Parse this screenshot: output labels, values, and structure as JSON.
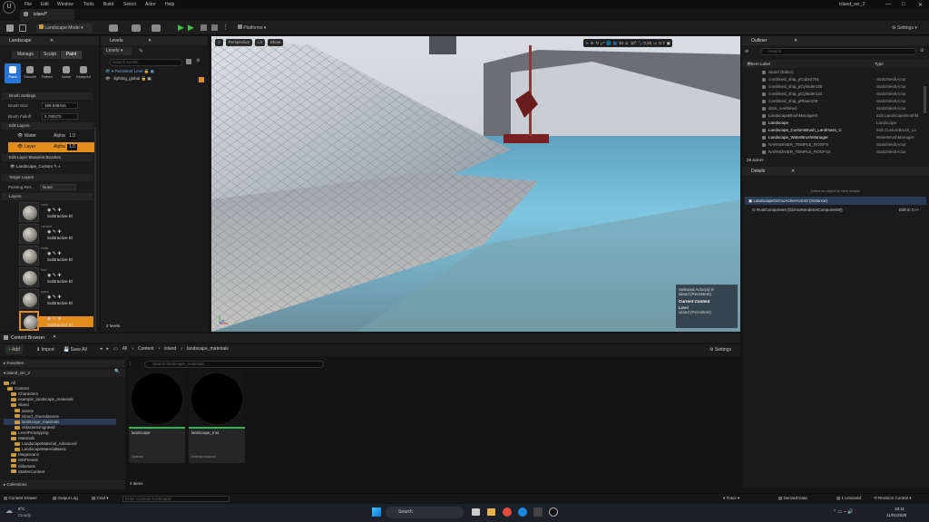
{
  "menu": {
    "items": [
      "File",
      "Edit",
      "Window",
      "Tools",
      "Build",
      "Select",
      "Actor",
      "Help"
    ],
    "project": "island_ver_2"
  },
  "doc_tab": "island*",
  "toolbar": {
    "mode": "Landscape Mode",
    "platforms": "Platforms",
    "settings": "Settings"
  },
  "landscape_panel": {
    "title": "Landscape",
    "modes": [
      "Manage",
      "Sculpt",
      "Paint"
    ],
    "tools": [
      "Paint",
      "Smooth",
      "Flatten",
      "Noise",
      "Blueprint"
    ],
    "brush_section": "Brush Settings",
    "brush_size_label": "Brush Size",
    "brush_size": "199.536316",
    "brush_falloff_label": "Brush Falloff",
    "brush_falloff": "0.780372",
    "edit_layers": "Edit Layers",
    "edit_layer_rows": [
      {
        "name": "Water",
        "alpha_label": "Alpha",
        "alpha": "1.0"
      },
      {
        "name": "Layer",
        "alpha_label": "Alpha",
        "alpha": "1.0"
      }
    ],
    "blueprint_section": "Edit Layer Blueprint Brushes",
    "blueprint_brush": "Landscape_Custom",
    "target_section": "Target Layers",
    "painting_label": "Painting Res...",
    "painting_value": "None",
    "layers_label": "Layers",
    "layer_items": [
      {
        "small": "sand",
        "label": "Subtractive Bl"
      },
      {
        "small": "cracked",
        "label": "Subtractive Bl"
      },
      {
        "small": "shale",
        "label": "Subtractive Bl"
      },
      {
        "small": "flow",
        "label": "Subtractive Bl"
      },
      {
        "small": "grass",
        "label": "Subtractive Bl"
      },
      {
        "small": "",
        "label": "Subtractive Bl"
      }
    ]
  },
  "levels_panel": {
    "title": "Levels",
    "dropdown": "Levels",
    "search_placeholder": "Search Levels",
    "rows": [
      "Persistent Leve",
      "lighting_global"
    ],
    "footer": "2 levels"
  },
  "viewport": {
    "perspective": "Perspective",
    "lit": "Lit",
    "show": "Show",
    "snap_grid": "10",
    "snap_rot": "10°",
    "snap_scale": "0.25",
    "cam_speed": "0.7",
    "overlay_l1": "Selected Actor(s) in",
    "overlay_l2": "island (Persistent)",
    "current_label": "Current Content",
    "level_label": "Level",
    "level_value": "island (Persistent)"
  },
  "outliner": {
    "title": "Outliner",
    "search_placeholder": "Search",
    "col_label": "Item Label",
    "col_type": "Type",
    "rows": [
      {
        "name": "island (Editor)",
        "type": ""
      },
      {
        "name": "combined_ship_pCube2791",
        "type": "StaticMeshActor"
      },
      {
        "name": "combined_ship_pCylinder138",
        "type": "StaticMeshActor"
      },
      {
        "name": "combined_ship_pCylinder144",
        "type": "StaticMeshActor"
      },
      {
        "name": "combined_ship_pPlane109",
        "type": "StaticMeshActor"
      },
      {
        "name": "dock_combined",
        "type": "StaticMeshActor"
      },
      {
        "name": "LandscapeBrushManager0",
        "type": "Edit LandscapeBrushM"
      },
      {
        "name": "Landscape",
        "type": "Landscape"
      },
      {
        "name": "Landscape_CustomBrush_Landmass_C",
        "type": "Edit CustomBrush_La"
      },
      {
        "name": "Landscape_WaterBrushManager",
        "type": "WaterBrushManager"
      },
      {
        "name": "NARNONIER_TEMPLE_ROOFS",
        "type": "StaticMeshActor"
      },
      {
        "name": "NARNONIER_TEMPLE_ROOFS2",
        "type": "StaticMeshActor"
      }
    ],
    "count": "29 actors"
  },
  "details": {
    "title": "Details",
    "hint": "Select an object to view details",
    "row1": "LandscapeGizmoActiveActor0 (Instance)",
    "row2": "RootComponent (GizmoRendererComponent0)",
    "row2_link": "Edit in C++"
  },
  "content_browser": {
    "title": "Content Browser",
    "add": "Add",
    "import": "Import",
    "save_all": "Save All",
    "path": [
      "All",
      "Content",
      "island",
      "landscape_materials"
    ],
    "settings": "Settings",
    "favorites": "Favorites",
    "project": "island_ver_2",
    "search_placeholder": "Search landscape_materials",
    "tree": [
      {
        "label": "All",
        "depth": 0
      },
      {
        "label": "Content",
        "depth": 1
      },
      {
        "label": "Characters",
        "depth": 2
      },
      {
        "label": "example_landscape_materials",
        "depth": 2
      },
      {
        "label": "island",
        "depth": 2
      },
      {
        "label": "assets",
        "depth": 3
      },
      {
        "label": "island_sharedassets",
        "depth": 3
      },
      {
        "label": "landscape_materials",
        "depth": 3
      },
      {
        "label": "oldassetsmigrated",
        "depth": 3
      },
      {
        "label": "LevelPrototyping",
        "depth": 2
      },
      {
        "label": "Materials",
        "depth": 2
      },
      {
        "label": "LandscapeMaterial_Advanced",
        "depth": 3
      },
      {
        "label": "LandscapeMaterialBasic",
        "depth": 3
      },
      {
        "label": "Megascans",
        "depth": 2
      },
      {
        "label": "MSPresets",
        "depth": 2
      },
      {
        "label": "oldassets",
        "depth": 2
      },
      {
        "label": "StarterContent",
        "depth": 2
      }
    ],
    "collections": "Collections",
    "assets": [
      {
        "name": "landscape",
        "type": "Material"
      },
      {
        "name": "landscape_Inst",
        "type": "Material Instance"
      }
    ],
    "count": "2 items"
  },
  "statusbar": {
    "drawer": "Content Drawer",
    "output": "Output Log",
    "cmd": "Cmd",
    "console_placeholder": "Enter Console Command",
    "trace": "Trace",
    "derived": "Derived Data",
    "unsaved": "1 Unsaved",
    "revision": "Revision Control"
  },
  "taskbar": {
    "temp": "9°C",
    "weather": "Cloudy",
    "search": "Search",
    "time": "18:11",
    "date": "11/01/2025"
  }
}
